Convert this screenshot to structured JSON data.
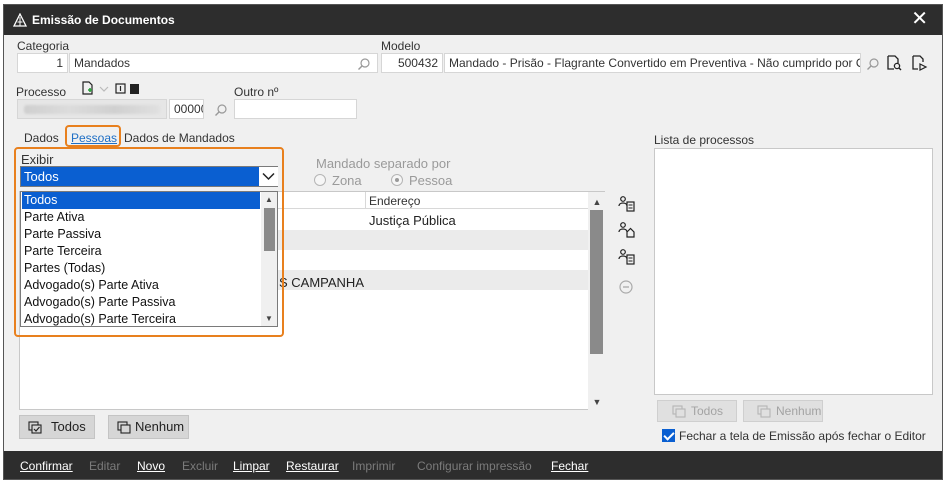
{
  "window": {
    "title": "Emissão de Documentos",
    "close_symbol": "✕"
  },
  "header": {
    "categoria_label": "Categoria",
    "categoria_code": "1",
    "categoria_name": "Mandados",
    "modelo_label": "Modelo",
    "modelo_code": "500432",
    "modelo_name": "Mandado - Prisão - Flagrante Convertido em Preventiva - Não cumprido por Oficial",
    "processo_label": "Processo",
    "processo_suffix": "00000",
    "outro_label": "Outro nº",
    "outro_value": ""
  },
  "tabs": [
    {
      "label": "Dados"
    },
    {
      "label": "Pessoas"
    },
    {
      "label": "Dados de Mandados"
    }
  ],
  "exibir": {
    "label": "Exibir",
    "selected": "Todos",
    "options": [
      "Todos",
      "Parte Ativa",
      "Parte Passiva",
      "Parte Terceira",
      "Partes (Todas)",
      "Advogado(s) Parte Ativa",
      "Advogado(s) Parte Passiva",
      "Advogado(s) Parte Terceira"
    ]
  },
  "mandado_separado": {
    "label": "Mandado separado por",
    "options": [
      {
        "label": "Zona",
        "checked": false
      },
      {
        "label": "Pessoa",
        "checked": true
      }
    ]
  },
  "grid": {
    "column_endereco": "Endereço",
    "row1_endereco": "Justiça Pública",
    "row3_fragment": "S CAMPANHA"
  },
  "buttons": {
    "todos": "Todos",
    "nenhum": "Nenhum"
  },
  "lista": {
    "label": "Lista de processos",
    "todos": "Todos",
    "nenhum": "Nenhum",
    "fechar_checkbox": "Fechar a tela de Emissão após fechar o Editor",
    "fechar_checked": true
  },
  "footer": [
    {
      "label": "Confirmar",
      "enabled": true
    },
    {
      "label": "Editar",
      "enabled": false
    },
    {
      "label": "Novo",
      "enabled": true
    },
    {
      "label": "Excluir",
      "enabled": false
    },
    {
      "label": "Limpar",
      "enabled": true
    },
    {
      "label": "Restaurar",
      "enabled": true
    },
    {
      "label": "Imprimir",
      "enabled": false
    },
    {
      "label": "Configurar impressão",
      "enabled": false
    },
    {
      "label": "Fechar",
      "enabled": true
    }
  ],
  "colors": {
    "titlebar": "#2d2d2d",
    "highlight": "#e8801e",
    "selection": "#0a5fd1",
    "active_tab": "#1f6fc5"
  }
}
